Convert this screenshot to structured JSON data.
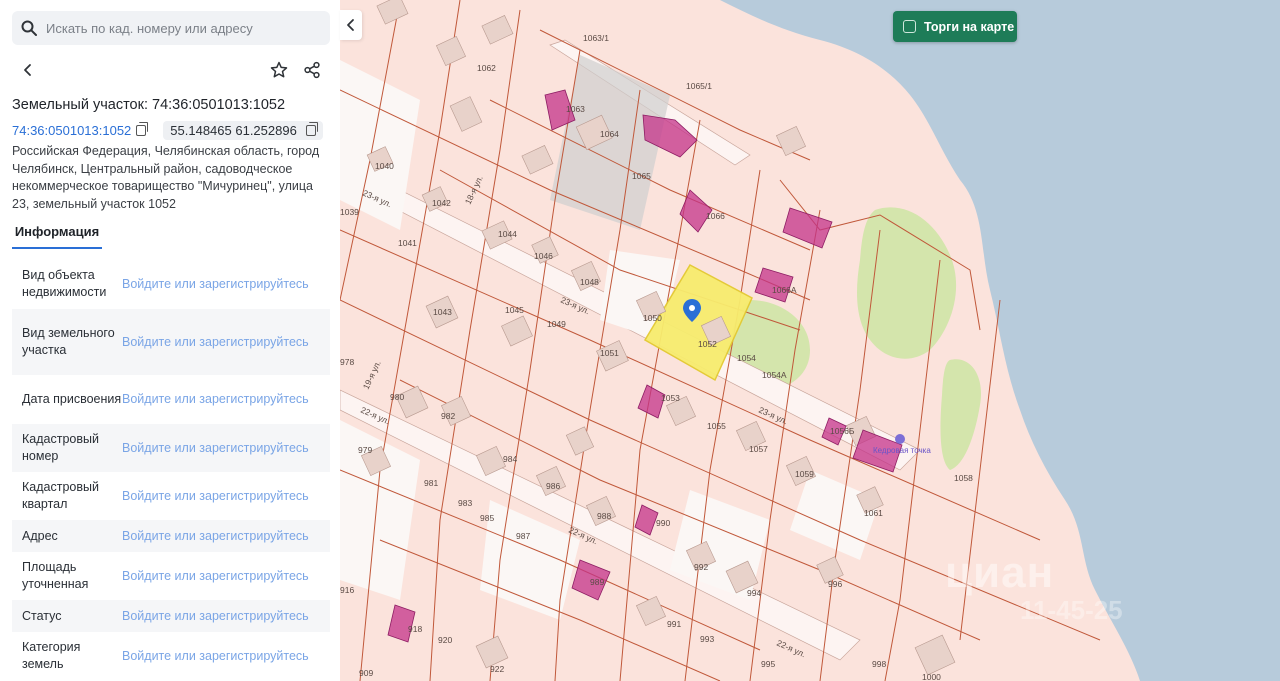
{
  "search": {
    "placeholder": "Искать по кад. номеру или адресу"
  },
  "parcel": {
    "title": "Земельный участок: 74:36:0501013:1052",
    "cad_number": "74:36:0501013:1052",
    "coords": "55.148465 61.252896",
    "address": "Российская Федерация, Челябинская область, город Челябинск, Центральный район, садоводческое некоммерческое товарищество \"Мичуринец\", улица 23, земельный участок 1052"
  },
  "tabs": {
    "info": "Информация"
  },
  "info_rows": [
    {
      "label": "Вид объекта недвижимости",
      "value": "Войдите или зарегистрируйтесь"
    },
    {
      "label": "Вид земельного участка",
      "value": "Войдите или зарегистрируйтесь"
    },
    {
      "label": "Дата присвоения",
      "value": "Войдите или зарегистрируйтесь"
    },
    {
      "label": "Кадастровый номер",
      "value": "Войдите или зарегистрируйтесь"
    },
    {
      "label": "Кадастровый квартал",
      "value": "Войдите или зарегистрируйтесь"
    },
    {
      "label": "Адрес",
      "value": "Войдите или зарегистрируйтесь"
    },
    {
      "label": "Площадь уточненная",
      "value": "Войдите или зарегистрируйтесь"
    },
    {
      "label": "Статус",
      "value": "Войдите или зарегистрируйтесь"
    },
    {
      "label": "Категория земель",
      "value": "Войдите или зарегистрируйтесь"
    }
  ],
  "map": {
    "auction_toggle": "Торги на карте",
    "watermark": "циан",
    "watermark_sub": "11-45-25",
    "poi_label": "Кедровая точка",
    "streets": [
      "23-я ул.",
      "23-я ул.",
      "23-я ул.",
      "22-я ул.",
      "22-я ул.",
      "22-я ул.",
      "18-я ул.",
      "19-я ул."
    ],
    "parcel_numbers": [
      "1063/1",
      "1062",
      "1065/1",
      "1063",
      "1064",
      "1065",
      "1066",
      "1040",
      "1042",
      "1039",
      "1044",
      "1041",
      "1046",
      "1048",
      "1066А",
      "1043",
      "1045",
      "1049",
      "1050",
      "1052",
      "1054",
      "1054А",
      "1051",
      "978",
      "980",
      "982",
      "1053",
      "1055",
      "1057",
      "1056Б",
      "1059",
      "979",
      "981",
      "983",
      "984",
      "986",
      "985",
      "988",
      "987",
      "990",
      "992",
      "994",
      "996",
      "916",
      "989",
      "918",
      "920",
      "922",
      "991",
      "993",
      "995",
      "998",
      "1061",
      "1058",
      "909",
      "1000"
    ],
    "colors": {
      "land": "#fbe3dc",
      "water": "#b7cbdb",
      "parcel_border": "#c0583a",
      "selected_fill": "#f7ec6e",
      "building": "#c4338a",
      "green": "#cfe4a6",
      "accent": "#2a6fd6",
      "auction": "#1e7c58"
    }
  }
}
